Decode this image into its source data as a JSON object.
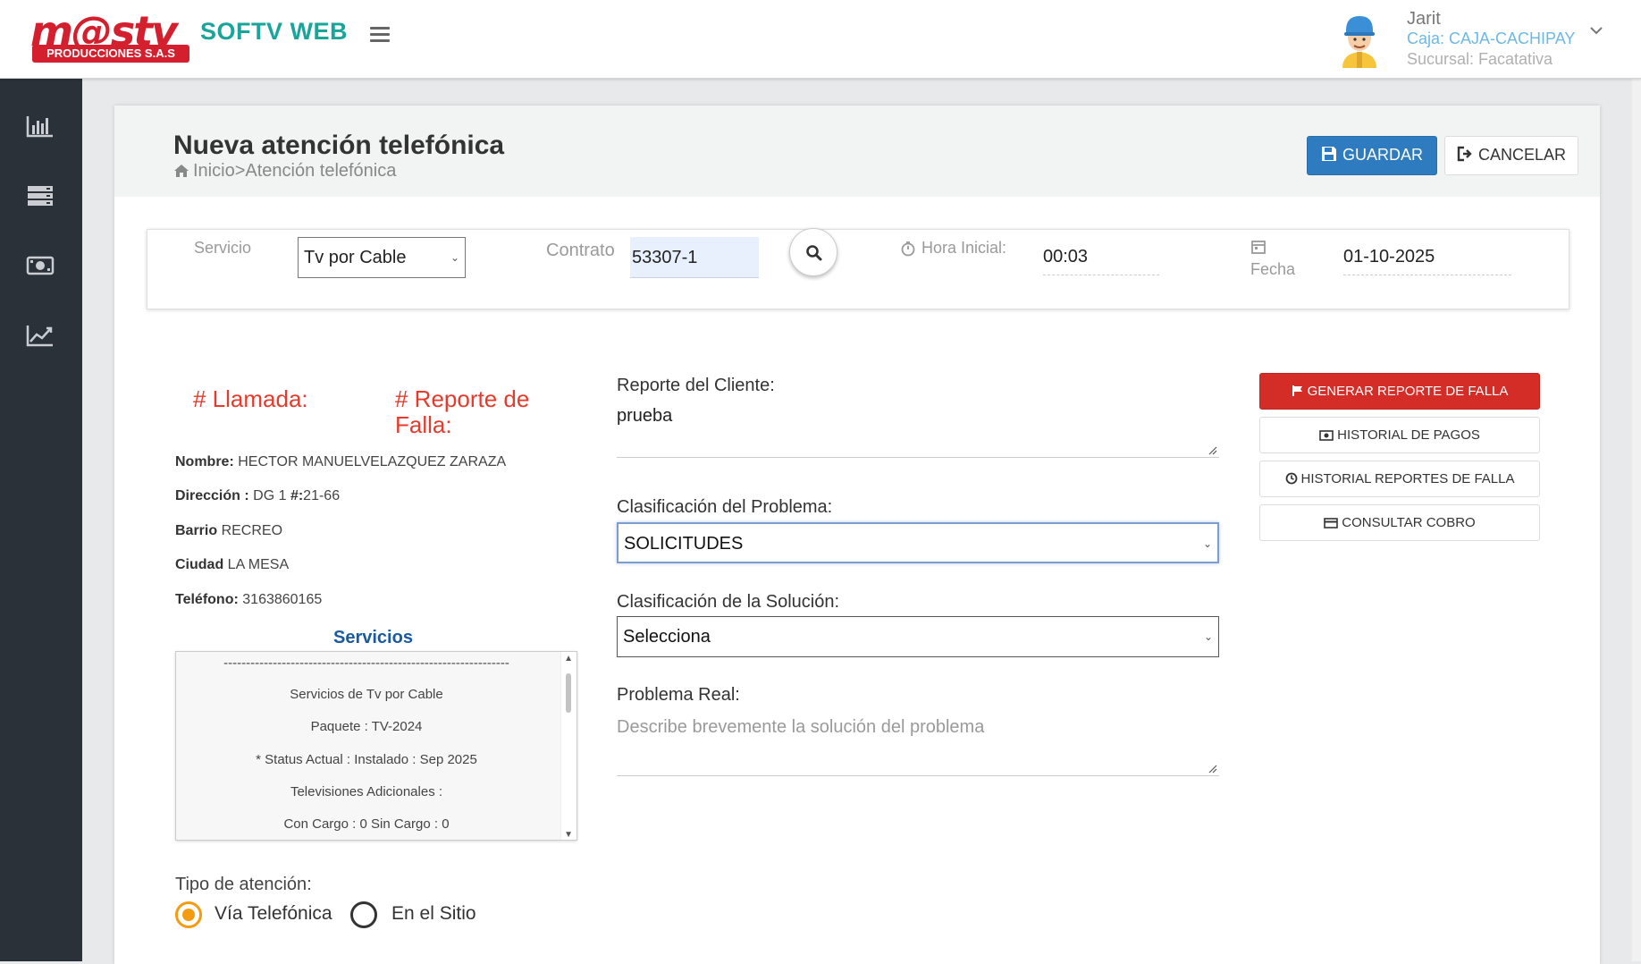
{
  "header": {
    "logo_main": "m@stv",
    "logo_sub": "PRODUCCIONES S.A.S",
    "app_title": "SOFTV WEB",
    "user": {
      "name": "Jarit",
      "caja": "Caja: CAJA-CACHIPAY",
      "sucursal": "Sucursal: Facatativa"
    }
  },
  "sidebar": {
    "items": [
      {
        "icon": "bar-chart-icon"
      },
      {
        "icon": "server-icon"
      },
      {
        "icon": "money-icon"
      },
      {
        "icon": "line-chart-icon"
      }
    ]
  },
  "page": {
    "title": "Nueva atención telefónica",
    "breadcrumb": "Inicio>Atención telefónica",
    "save_label": "GUARDAR",
    "cancel_label": "CANCELAR"
  },
  "search": {
    "servicio_label": "Servicio",
    "servicio_value": "Tv por Cable",
    "contrato_label": "Contrato",
    "contrato_value": "53307-1",
    "hora_label": "Hora Inicial:",
    "hora_value": "00:03",
    "fecha_label": "Fecha",
    "fecha_value": "01-10-2025"
  },
  "client": {
    "llamada_label": "# Llamada:",
    "reporte_label_1": "# Reporte de",
    "reporte_label_2": "Falla:",
    "nombre_label": "Nombre:",
    "nombre_value": "HECTOR MANUELVELAZQUEZ ZARAZA",
    "direccion_label": "Dirección :",
    "direccion_value": "DG 1 ",
    "direccion_num_label": "#:",
    "direccion_num_value": "21-66",
    "barrio_label": "Barrio",
    "barrio_value": "RECREO",
    "ciudad_label": "Ciudad",
    "ciudad_value": "LA MESA",
    "telefono_label": "Teléfono:",
    "telefono_value": "3163860165"
  },
  "servicios": {
    "title": "Servicios",
    "lines": [
      "----------------------------------------------------------------",
      "Servicios de Tv por Cable",
      "Paquete : TV-2024",
      "* Status Actual : Instalado : Sep 2025",
      "Televisiones Adicionales :",
      "Con Cargo : 0 Sin Cargo : 0"
    ]
  },
  "tipo_atencion": {
    "label": "Tipo de atención:",
    "option_1": "Vía Telefónica",
    "option_2": "En el Sitio",
    "selected": "Vía Telefónica"
  },
  "form": {
    "reporte_label": "Reporte del Cliente:",
    "reporte_value": "prueba",
    "clasif_problema_label": "Clasificación del Problema:",
    "clasif_problema_value": "SOLICITUDES",
    "clasif_solucion_label": "Clasificación de la Solución:",
    "clasif_solucion_value": "Selecciona",
    "problema_real_label": "Problema Real:",
    "problema_real_placeholder": "Describe brevemente la solución del problema"
  },
  "actions": {
    "generar_reporte": "GENERAR REPORTE DE FALLA",
    "historial_pagos": "HISTORIAL DE PAGOS",
    "historial_reportes": "HISTORIAL REPORTES DE FALLA",
    "consultar_cobro": "CONSULTAR COBRO"
  },
  "colors": {
    "brand_red": "#d4202e",
    "brand_teal": "#1aa59a",
    "primary_blue": "#2e7cbf",
    "danger_red": "#d42c26",
    "label_red": "#e53a2c",
    "radio_orange": "#f39c12",
    "sidebar": "#2a3138"
  }
}
